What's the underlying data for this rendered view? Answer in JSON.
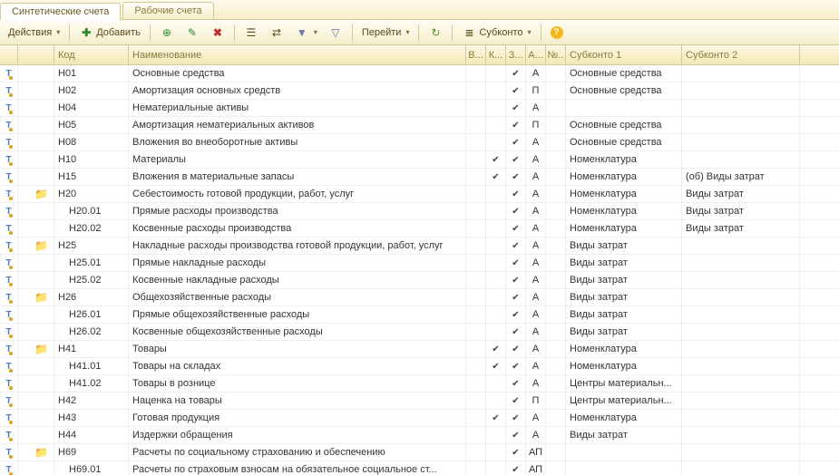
{
  "tabs": {
    "t1": "Синтетические счета",
    "t2": "Рабочие счета"
  },
  "toolbar": {
    "actions": "Действия",
    "add": "Добавить",
    "goto": "Перейти",
    "subkonto": "Субконто"
  },
  "headers": {
    "code": "Код",
    "name": "Наименование",
    "v": "В...",
    "k": "К...",
    "z": "З...",
    "a": "А...",
    "n": "№..",
    "s1": "Субконто 1",
    "s2": "Субконто 2"
  },
  "rows": [
    {
      "fold": false,
      "code": "Н01",
      "name": "Основные средства",
      "k": false,
      "z": true,
      "a": "А",
      "s1": "Основные средства",
      "s2": ""
    },
    {
      "fold": false,
      "code": "Н02",
      "name": "Амортизация основных средств",
      "k": false,
      "z": true,
      "a": "П",
      "s1": "Основные средства",
      "s2": ""
    },
    {
      "fold": false,
      "code": "Н04",
      "name": "Нематериальные активы",
      "k": false,
      "z": true,
      "a": "А",
      "s1": "",
      "s2": ""
    },
    {
      "fold": false,
      "code": "Н05",
      "name": "Амортизация нематериальных активов",
      "k": false,
      "z": true,
      "a": "П",
      "s1": "Основные средства",
      "s2": ""
    },
    {
      "fold": false,
      "code": "Н08",
      "name": "Вложения во внеоборотные активы",
      "k": false,
      "z": true,
      "a": "А",
      "s1": "Основные средства",
      "s2": ""
    },
    {
      "fold": false,
      "code": "Н10",
      "name": "Материалы",
      "k": true,
      "z": true,
      "a": "А",
      "s1": "Номенклатура",
      "s2": ""
    },
    {
      "fold": false,
      "code": "Н15",
      "name": "Вложения в материальные запасы",
      "k": true,
      "z": true,
      "a": "А",
      "s1": "Номенклатура",
      "s2": "(об) Виды затрат"
    },
    {
      "fold": true,
      "code": "Н20",
      "name": "Себестоимость готовой продукции, работ, услуг",
      "k": false,
      "z": true,
      "a": "А",
      "s1": "Номенклатура",
      "s2": "Виды затрат"
    },
    {
      "fold": false,
      "indent": true,
      "code": "Н20.01",
      "name": "Прямые расходы производства",
      "k": false,
      "z": true,
      "a": "А",
      "s1": "Номенклатура",
      "s2": "Виды затрат"
    },
    {
      "fold": false,
      "indent": true,
      "code": "Н20.02",
      "name": "Косвенные расходы производства",
      "k": false,
      "z": true,
      "a": "А",
      "s1": "Номенклатура",
      "s2": "Виды затрат"
    },
    {
      "fold": true,
      "code": "Н25",
      "name": "Накладные расходы производства готовой продукции, работ, услуг",
      "k": false,
      "z": true,
      "a": "А",
      "s1": "Виды затрат",
      "s2": ""
    },
    {
      "fold": false,
      "indent": true,
      "code": "Н25.01",
      "name": "Прямые накладные расходы",
      "k": false,
      "z": true,
      "a": "А",
      "s1": "Виды затрат",
      "s2": ""
    },
    {
      "fold": false,
      "indent": true,
      "code": "Н25.02",
      "name": "Косвенные накладные расходы",
      "k": false,
      "z": true,
      "a": "А",
      "s1": "Виды затрат",
      "s2": ""
    },
    {
      "fold": true,
      "code": "Н26",
      "name": "Общехозяйственные расходы",
      "k": false,
      "z": true,
      "a": "А",
      "s1": "Виды затрат",
      "s2": ""
    },
    {
      "fold": false,
      "indent": true,
      "code": "Н26.01",
      "name": "Прямые общехозяйственные расходы",
      "k": false,
      "z": true,
      "a": "А",
      "s1": "Виды затрат",
      "s2": ""
    },
    {
      "fold": false,
      "indent": true,
      "code": "Н26.02",
      "name": "Косвенные общехозяйственные расходы",
      "k": false,
      "z": true,
      "a": "А",
      "s1": "Виды затрат",
      "s2": ""
    },
    {
      "fold": true,
      "code": "Н41",
      "name": "Товары",
      "k": true,
      "z": true,
      "a": "А",
      "s1": "Номенклатура",
      "s2": ""
    },
    {
      "fold": false,
      "indent": true,
      "code": "Н41.01",
      "name": "Товары на складах",
      "k": true,
      "z": true,
      "a": "А",
      "s1": "Номенклатура",
      "s2": ""
    },
    {
      "fold": false,
      "indent": true,
      "code": "Н41.02",
      "name": "Товары в рознице",
      "k": false,
      "z": true,
      "a": "А",
      "s1": "Центры материальн...",
      "s2": ""
    },
    {
      "fold": false,
      "code": "Н42",
      "name": "Наценка на товары",
      "k": false,
      "z": true,
      "a": "П",
      "s1": "Центры материальн...",
      "s2": ""
    },
    {
      "fold": false,
      "code": "Н43",
      "name": "Готовая продукция",
      "k": true,
      "z": true,
      "a": "А",
      "s1": "Номенклатура",
      "s2": ""
    },
    {
      "fold": false,
      "code": "Н44",
      "name": "Издержки обращения",
      "k": false,
      "z": true,
      "a": "А",
      "s1": "Виды затрат",
      "s2": ""
    },
    {
      "fold": true,
      "code": "Н69",
      "name": "Расчеты по социальному страхованию и обеспечению",
      "k": false,
      "z": true,
      "a": "АП",
      "s1": "",
      "s2": ""
    },
    {
      "fold": false,
      "indent": true,
      "code": "Н69.01",
      "name": "Расчеты по страховым взносам на обязательное социальное ст...",
      "k": false,
      "z": true,
      "a": "АП",
      "s1": "",
      "s2": ""
    }
  ]
}
